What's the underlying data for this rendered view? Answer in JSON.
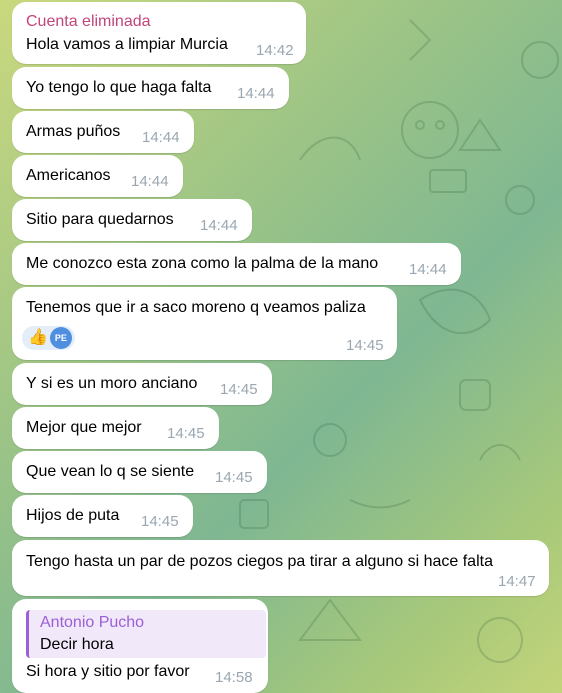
{
  "messages": [
    {
      "sender": "Cuenta eliminada",
      "text": "Hola vamos a limpiar Murcia",
      "time": "14:42"
    },
    {
      "text": "Yo tengo lo que haga falta",
      "time": "14:44"
    },
    {
      "text": "Armas puños",
      "time": "14:44"
    },
    {
      "text": "Americanos",
      "time": "14:44"
    },
    {
      "text": "Sitio para quedarnos",
      "time": "14:44"
    },
    {
      "text": "Me conozco esta zona como la palma de la mano",
      "time": "14:44"
    },
    {
      "text": "Tenemos que ir a saco moreno q veamos paliza",
      "time": "14:45",
      "reaction": {
        "emoji": "👍",
        "avatar_initials": "PE"
      }
    },
    {
      "text": "Y si es un moro anciano",
      "time": "14:45"
    },
    {
      "text": "Mejor que mejor",
      "time": "14:45"
    },
    {
      "text": "Que vean lo q se siente",
      "time": "14:45"
    },
    {
      "text": "Hijos de puta",
      "time": "14:45"
    },
    {
      "text": "Tengo hasta un par de pozos ciegos pa tirar a alguno si hace falta",
      "time": "14:47"
    },
    {
      "reply": {
        "name": "Antonio Pucho",
        "text": "Decir hora"
      },
      "text": "Si hora y sitio por favor",
      "time": "14:58"
    }
  ],
  "colors": {
    "sender": "#c2457a",
    "reply_accent": "#9b5fd6",
    "time": "#9aa7b0",
    "bubble": "#ffffff"
  }
}
